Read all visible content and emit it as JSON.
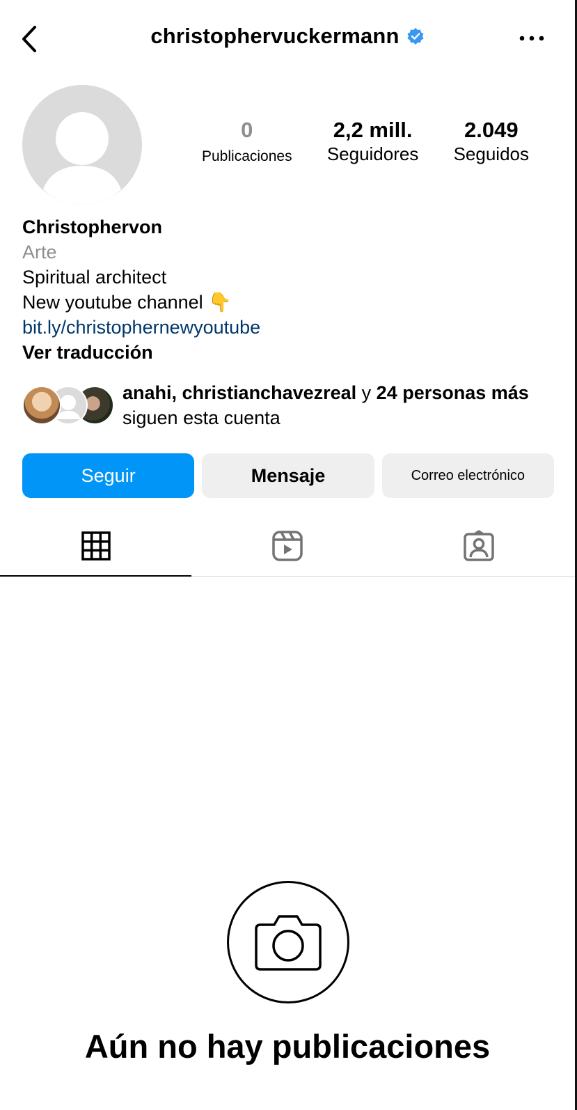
{
  "header": {
    "username": "christophervuckermann",
    "verified": true,
    "accent": "#3897f0"
  },
  "profile": {
    "stats": [
      {
        "value": "0",
        "label": "Publicaciones"
      },
      {
        "value": "2,2 mill.",
        "label": "Seguidores"
      },
      {
        "value": "2.049",
        "label": "Seguidos"
      }
    ],
    "name": "Christophervon",
    "category": "Arte",
    "bio_line1": "Spiritual architect",
    "bio_line2": "New youtube channel 👇",
    "link": "bit.ly/christophernewyoutube",
    "translate": "Ver traducción"
  },
  "followed_by": {
    "names": "anahi, christianchavezreal",
    "connector": " y ",
    "others": "24 personas más",
    "suffix": "siguen esta cuenta"
  },
  "buttons": {
    "follow": "Seguir",
    "message": "Mensaje",
    "email": "Correo electrónico"
  },
  "tabs": [
    "grid-icon",
    "reels-icon",
    "tagged-icon"
  ],
  "empty_state": {
    "title": "Aún no hay publicaciones",
    "icon": "camera-icon"
  },
  "colors": {
    "primary_button": "#0095f6",
    "secondary_button": "#efefef",
    "muted_text": "#8e8e8e",
    "link": "#00376b"
  }
}
